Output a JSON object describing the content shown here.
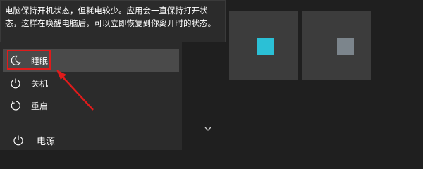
{
  "tooltip": {
    "line1": "电脑保持开机状态，但耗电较少。应用会一直保持打开状",
    "line2": "态，这样在唤醒电脑后，可以立即恢复到你离开时的状态。"
  },
  "power_menu": {
    "items": [
      {
        "label": "睡眠",
        "icon": "moon-icon"
      },
      {
        "label": "关机",
        "icon": "power-icon"
      },
      {
        "label": "重启",
        "icon": "restart-icon"
      }
    ]
  },
  "start_sidebar": {
    "power_label": "电源",
    "power_icon": "power-icon"
  },
  "tiles": [
    {
      "color": "#2bc0d6"
    },
    {
      "color": "#7c858c"
    }
  ],
  "colors": {
    "highlight": "#e01b1b",
    "panel": "#2b2b2b",
    "hover": "#4a4a4a",
    "tile": "#3c3c3c"
  }
}
